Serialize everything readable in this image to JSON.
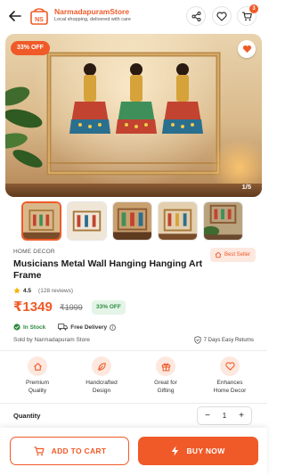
{
  "header": {
    "logo_text": "NS",
    "store_name": "NarmadapuramStore",
    "tagline": "Local shopping, delivered with care",
    "cart_count": "3"
  },
  "hero": {
    "discount_badge": "33% OFF",
    "image_counter": "1/5"
  },
  "thumbnails": {
    "count": 5,
    "active_index": 0
  },
  "product": {
    "category": "HOME DECOR",
    "best_seller_label": "Best Seller",
    "title": "Musicians Metal Wall Hanging Hanging Art Frame",
    "rating": "4.5",
    "reviews": "(128 reviews)",
    "price": "₹1349",
    "mrp": "₹1999",
    "discount": "33% OFF",
    "stock_status": "In Stock",
    "delivery": "Free Delivery",
    "sold_by": "Sold by Narmadapuram Store",
    "returns": "7 Days Easy Returns"
  },
  "features": [
    {
      "icon": "home-icon",
      "label": "Premium\nQuality"
    },
    {
      "icon": "leaf-icon",
      "label": "Handcrafted\nDesign"
    },
    {
      "icon": "gift-icon",
      "label": "Great for\nGifting"
    },
    {
      "icon": "heart-icon",
      "label": "Enhances\nHome Decor"
    }
  ],
  "quantity": {
    "label": "Quantity",
    "value": "1",
    "minus": "−",
    "plus": "+"
  },
  "actions": {
    "add_to_cart": "ADD TO CART",
    "buy_now": "BUY NOW"
  },
  "colors": {
    "accent": "#f05a28",
    "success": "#2e8b3f",
    "accent_light": "#fde8e0"
  }
}
